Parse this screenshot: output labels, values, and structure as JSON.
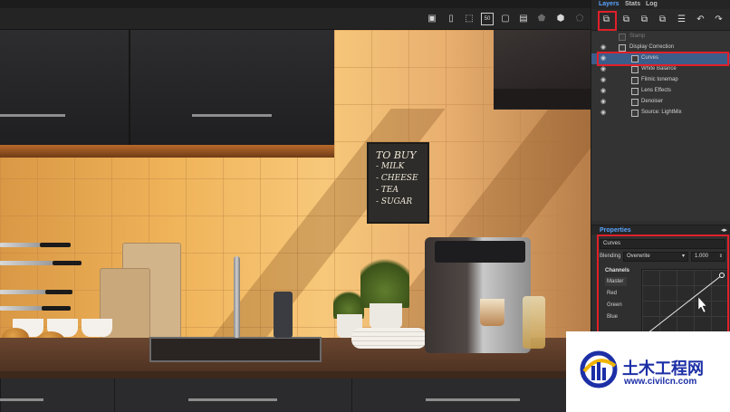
{
  "layers_panel": {
    "tabs": [
      "Layers",
      "Stats",
      "Log"
    ],
    "active_tab": "Layers",
    "toolbar_icons": [
      "add-layer-icon",
      "layer-icon",
      "layer-icon",
      "layer-icon",
      "list-icon",
      "undo-icon",
      "redo-icon"
    ],
    "layers": [
      {
        "name": "Stamp",
        "visible": false,
        "dim": true
      },
      {
        "name": "Display Correction",
        "visible": true
      },
      {
        "name": "Curves",
        "visible": true,
        "selected": true
      },
      {
        "name": "White Balance",
        "visible": true
      },
      {
        "name": "Filmic tonemap",
        "visible": true
      },
      {
        "name": "Lens Effects",
        "visible": true
      },
      {
        "name": "Denoiser",
        "visible": true
      },
      {
        "name": "Source: LightMix",
        "visible": true
      }
    ]
  },
  "properties": {
    "header": "Properties",
    "layer_name": "Curves",
    "blending_label": "Blending",
    "blending_value": "Overwrite",
    "opacity_value": "1.000",
    "channels_label": "Channels",
    "channels": [
      "Master",
      "Red",
      "Green",
      "Blue"
    ],
    "active_channel": "Master"
  },
  "viewport": {
    "chalkboard_lines": [
      "TO BUY",
      "- MILK",
      "- CHEESE",
      "- TEA",
      "- SUGAR"
    ]
  },
  "watermark": {
    "title": "土木工程网",
    "url": "www.civilcn.com"
  },
  "colors": {
    "highlight_red": "#e0202a",
    "selection_blue": "#3c5d8a",
    "watermark_blue": "#1c2fa6"
  }
}
